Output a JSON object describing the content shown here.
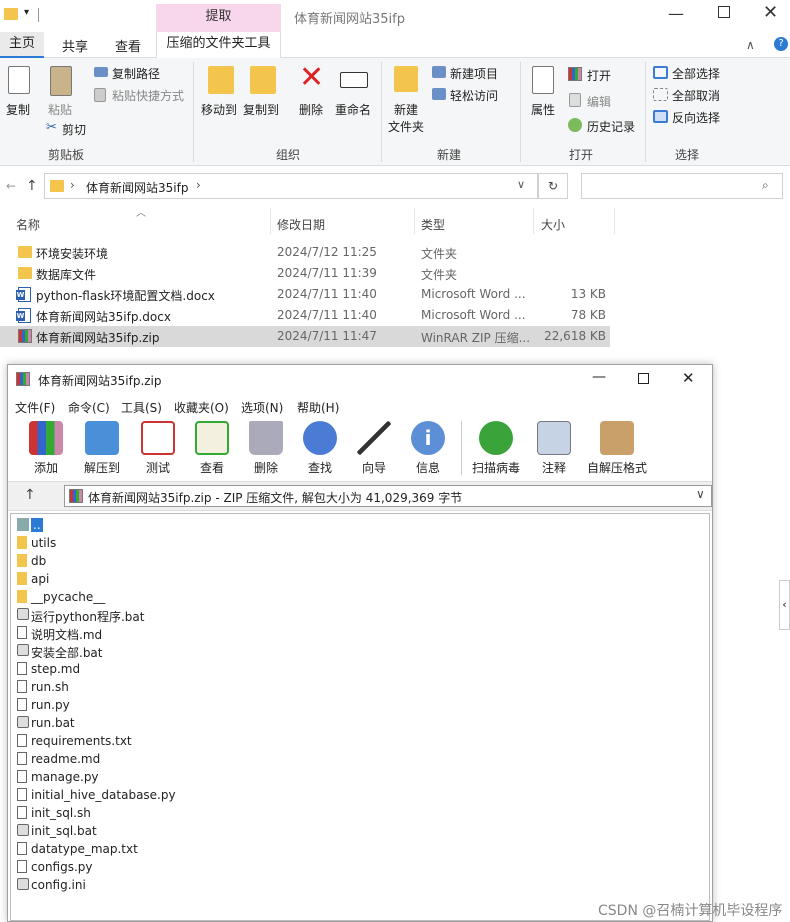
{
  "explorer": {
    "window_title": "体育新闻网站35ifp",
    "context_tab": "提取",
    "tabs": [
      "主页",
      "共享",
      "查看",
      "压缩的文件夹工具"
    ],
    "ribbon": {
      "clipboard": {
        "copy": "复制",
        "paste": "粘贴",
        "copy_path": "复制路径",
        "paste_shortcut": "粘贴快捷方式",
        "cut": "剪切",
        "label": "剪贴板"
      },
      "organize": {
        "move_to": "移动到",
        "copy_to": "复制到",
        "delete": "删除",
        "rename": "重命名",
        "label": "组织"
      },
      "new": {
        "new_folder": "新建\n文件夹",
        "new_folder_1": "新建",
        "new_folder_2": "文件夹",
        "new_item": "新建项目",
        "easy_access": "轻松访问",
        "label": "新建"
      },
      "open": {
        "properties": "属性",
        "open": "打开",
        "edit": "编辑",
        "history": "历史记录",
        "label": "打开"
      },
      "select": {
        "select_all": "全部选择",
        "select_none": "全部取消",
        "invert": "反向选择",
        "label": "选择"
      }
    },
    "address": {
      "breadcrumb": "体育新闻网站35ifp",
      "search_placeholder": ""
    },
    "columns": {
      "name": "名称",
      "date": "修改日期",
      "type": "类型",
      "size": "大小"
    },
    "files": [
      {
        "name": "环境安装环境",
        "date": "2024/7/12 11:25",
        "type": "文件夹",
        "size": "",
        "icon": "folder-icon"
      },
      {
        "name": "数据库文件",
        "date": "2024/7/11 11:39",
        "type": "文件夹",
        "size": "",
        "icon": "folder-icon"
      },
      {
        "name": "python-flask环境配置文档.docx",
        "date": "2024/7/11 11:40",
        "type": "Microsoft Word ...",
        "size": "13 KB",
        "icon": "word-doc-icon"
      },
      {
        "name": "体育新闻网站35ifp.docx",
        "date": "2024/7/11 11:40",
        "type": "Microsoft Word ...",
        "size": "78 KB",
        "icon": "word-doc-icon"
      },
      {
        "name": "体育新闻网站35ifp.zip",
        "date": "2024/7/11 11:47",
        "type": "WinRAR ZIP 压缩...",
        "size": "22,618 KB",
        "icon": "winrar-archive-icon"
      }
    ]
  },
  "winrar": {
    "title": "体育新闻网站35ifp.zip",
    "menu": [
      "文件(F)",
      "命令(C)",
      "工具(S)",
      "收藏夹(O)",
      "选项(N)",
      "帮助(H)"
    ],
    "toolbar": [
      "添加",
      "解压到",
      "测试",
      "查看",
      "删除",
      "查找",
      "向导",
      "信息",
      "扫描病毒",
      "注释",
      "自解压格式"
    ],
    "path_text": "体育新闻网站35ifp.zip - ZIP 压缩文件, 解包大小为 41,029,369 字节",
    "items": [
      {
        "name": "..",
        "kind": "up"
      },
      {
        "name": "utils",
        "kind": "folder"
      },
      {
        "name": "db",
        "kind": "folder"
      },
      {
        "name": "api",
        "kind": "folder"
      },
      {
        "name": "__pycache__",
        "kind": "folder"
      },
      {
        "name": "运行python程序.bat",
        "kind": "bat"
      },
      {
        "name": "说明文档.md",
        "kind": "file"
      },
      {
        "name": "安装全部.bat",
        "kind": "bat"
      },
      {
        "name": "step.md",
        "kind": "file"
      },
      {
        "name": "run.sh",
        "kind": "file"
      },
      {
        "name": "run.py",
        "kind": "file"
      },
      {
        "name": "run.bat",
        "kind": "bat"
      },
      {
        "name": "requirements.txt",
        "kind": "file"
      },
      {
        "name": "readme.md",
        "kind": "file"
      },
      {
        "name": "manage.py",
        "kind": "file"
      },
      {
        "name": "initial_hive_database.py",
        "kind": "file"
      },
      {
        "name": "init_sql.sh",
        "kind": "file"
      },
      {
        "name": "init_sql.bat",
        "kind": "bat"
      },
      {
        "name": "datatype_map.txt",
        "kind": "file"
      },
      {
        "name": "configs.py",
        "kind": "file"
      },
      {
        "name": "config.ini",
        "kind": "bat"
      }
    ]
  },
  "watermark": "CSDN @召楠计算机毕设程序"
}
